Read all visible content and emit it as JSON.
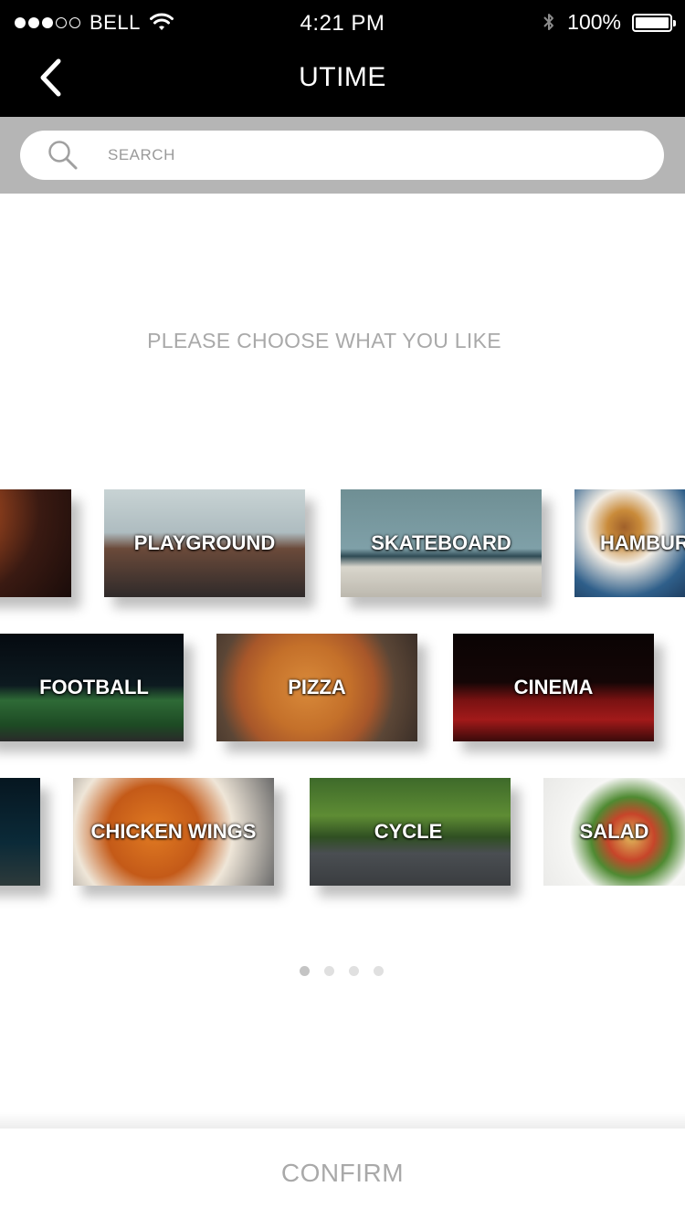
{
  "status_bar": {
    "carrier": "BELL",
    "time": "4:21 PM",
    "battery_percent": "100%",
    "signal_dots_filled": 3,
    "signal_dots_total": 5
  },
  "nav": {
    "title": "UTIME",
    "back_icon": "chevron-left-icon"
  },
  "search": {
    "placeholder": "SEARCH",
    "icon": "search-icon"
  },
  "prompt": "PLEASE CHOOSE WHAT YOU LIKE",
  "categories": {
    "row1": [
      {
        "label": ""
      },
      {
        "label": "PLAYGROUND"
      },
      {
        "label": "SKATEBOARD"
      },
      {
        "label": "HAMBURGER"
      }
    ],
    "row2": [
      {
        "label": "FOOTBALL"
      },
      {
        "label": "PIZZA"
      },
      {
        "label": "CINEMA"
      }
    ],
    "row3": [
      {
        "label": ""
      },
      {
        "label": "CHICKEN WINGS"
      },
      {
        "label": "CYCLE"
      },
      {
        "label": "SALAD"
      }
    ]
  },
  "pagination": {
    "total": 4,
    "active_index": 0
  },
  "confirm_label": "CONFIRM",
  "colors": {
    "header_bg": "#000000",
    "search_band_bg": "#b5b5b5",
    "muted_text": "#a9a9a9"
  }
}
